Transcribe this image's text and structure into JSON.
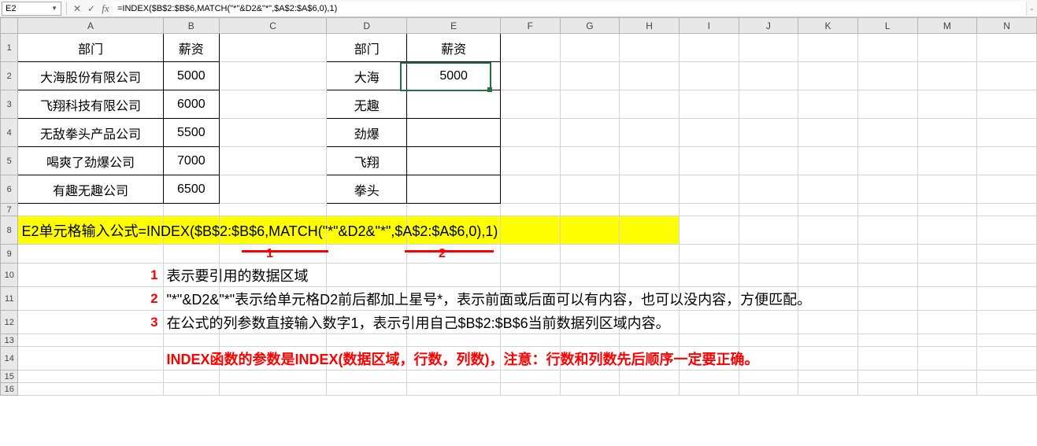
{
  "formula_bar": {
    "cell_ref": "E2",
    "formula": "=INDEX($B$2:$B$6,MATCH(\"*\"&D2&\"*\",$A$2:$A$6,0),1)"
  },
  "columns": [
    "A",
    "B",
    "C",
    "D",
    "E",
    "F",
    "G",
    "H",
    "I",
    "J",
    "K",
    "L",
    "M",
    "N"
  ],
  "rows": [
    "1",
    "2",
    "3",
    "4",
    "5",
    "6",
    "7",
    "8",
    "9",
    "10",
    "11",
    "12",
    "13",
    "14",
    "15",
    "16"
  ],
  "table1": {
    "headers": {
      "dept": "部门",
      "salary": "薪资"
    },
    "rows": [
      {
        "dept": "大海股份有限公司",
        "salary": "5000"
      },
      {
        "dept": "飞翔科技有限公司",
        "salary": "6000"
      },
      {
        "dept": "无敌拳头产品公司",
        "salary": "5500"
      },
      {
        "dept": "喝爽了劲爆公司",
        "salary": "7000"
      },
      {
        "dept": "有趣无趣公司",
        "salary": "6500"
      }
    ]
  },
  "table2": {
    "headers": {
      "dept": "部门",
      "salary": "薪资"
    },
    "rows": [
      {
        "dept": "大海",
        "salary": "5000"
      },
      {
        "dept": "无趣",
        "salary": ""
      },
      {
        "dept": "劲爆",
        "salary": ""
      },
      {
        "dept": "飞翔",
        "salary": ""
      },
      {
        "dept": "拳头",
        "salary": ""
      }
    ]
  },
  "highlight": {
    "text": "E2单元格输入公式=INDEX($B$2:$B$6,MATCH(\"*\"&D2&\"*\",$A$2:$A$6,0),1)",
    "underline_labels": {
      "l1": "1",
      "l2": "2"
    }
  },
  "notes": {
    "n1_num": "1",
    "n1_text": "表示要引用的数据区域",
    "n2_num": "2",
    "n2_text": "\"*\"&D2&\"*\"表示给单元格D2前后都加上星号*，表示前面或后面可以有内容，也可以没内容，方便匹配。",
    "n3_num": "3",
    "n3_text": "在公式的列参数直接输入数字1，表示引用自己$B$2:$B$6当前数据列区域内容。",
    "final": "INDEX函数的参数是INDEX(数据区域，行数，列数)，注意：行数和列数先后顺序一定要正确。"
  }
}
